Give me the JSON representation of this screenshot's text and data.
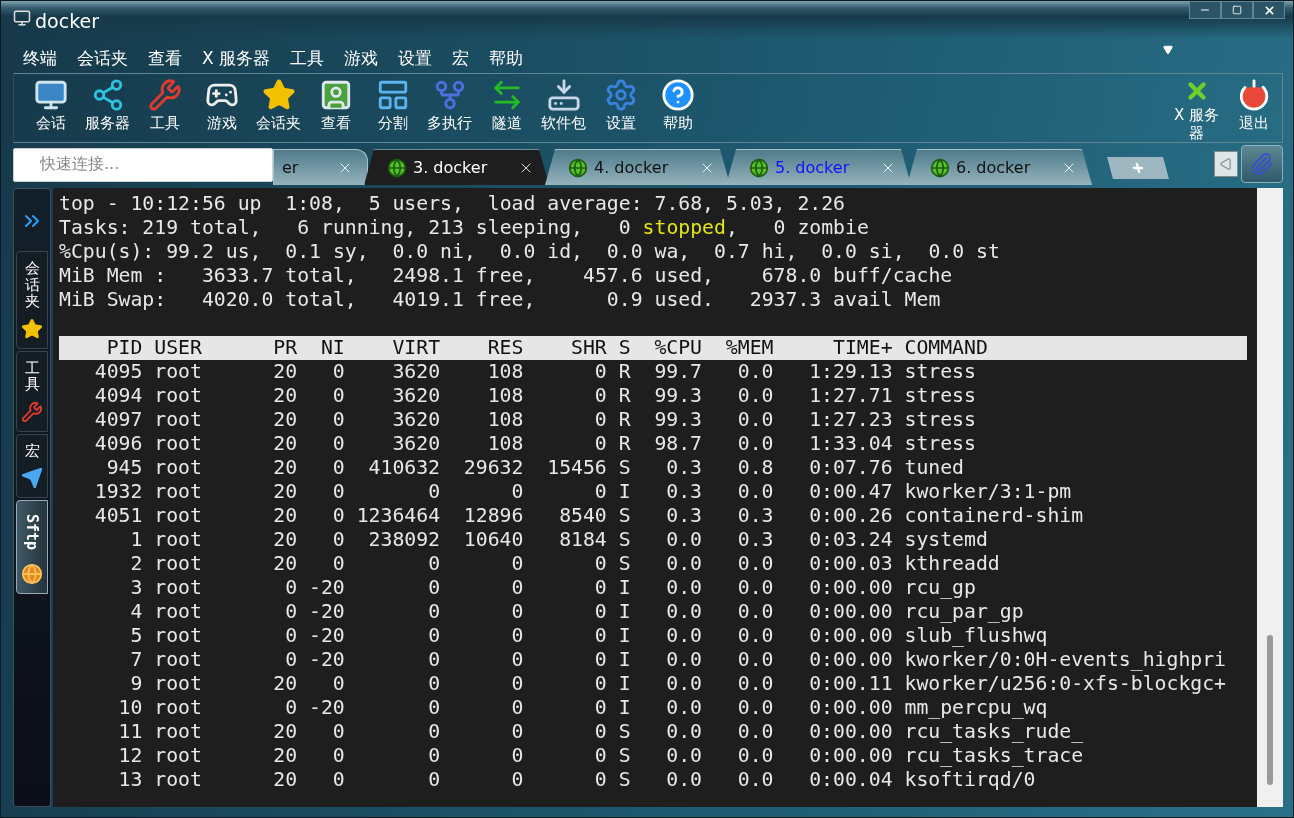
{
  "window": {
    "title": "docker"
  },
  "menu": [
    "终端",
    "会话夹",
    "查看",
    "X 服务器",
    "工具",
    "游戏",
    "设置",
    "宏",
    "帮助"
  ],
  "toolbar": [
    {
      "kind": "session",
      "label": "会话"
    },
    {
      "kind": "servers",
      "label": "服务器"
    },
    {
      "kind": "tools",
      "label": "工具"
    },
    {
      "kind": "games",
      "label": "游戏"
    },
    {
      "kind": "sessions",
      "label": "会话夹"
    },
    {
      "kind": "view",
      "label": "查看"
    },
    {
      "kind": "split",
      "label": "分割"
    },
    {
      "kind": "multiexec",
      "label": "多执行"
    },
    {
      "kind": "tunnel",
      "label": "隧道"
    },
    {
      "kind": "packages",
      "label": "软件包"
    },
    {
      "kind": "settings",
      "label": "设置"
    },
    {
      "kind": "help",
      "label": "帮助"
    }
  ],
  "toolbar_right": [
    {
      "kind": "xserver",
      "label": "X 服务器"
    },
    {
      "kind": "exit",
      "label": "退出"
    }
  ],
  "quick_connect": {
    "placeholder": "快速连接..."
  },
  "tabs": [
    {
      "label": "er",
      "selected": false,
      "activity": false,
      "icon": false
    },
    {
      "label": "3. docker",
      "selected": true,
      "activity": false,
      "icon": true
    },
    {
      "label": "4. docker",
      "selected": false,
      "activity": false,
      "icon": true
    },
    {
      "label": "5. docker",
      "selected": false,
      "activity": true,
      "icon": true
    },
    {
      "label": "6. docker",
      "selected": false,
      "activity": false,
      "icon": true
    }
  ],
  "side_tabs": [
    {
      "kind": "sessions",
      "label": "会话夹",
      "selected": false
    },
    {
      "kind": "tools",
      "label": "工具",
      "selected": false
    },
    {
      "kind": "macros",
      "label": "宏",
      "selected": false
    },
    {
      "kind": "sftp",
      "label": "Sftp",
      "selected": true
    }
  ],
  "summary": [
    [
      {
        "text": "top - 10:12:56 up  1:08,  5 users,  load average: 7.68, 5.03, 2.26",
        "highlight": false
      }
    ],
    [
      {
        "text": "Tasks: 219 total,   6 running, 213 sleeping,   0 ",
        "highlight": false
      },
      {
        "text": "stopped",
        "highlight": true
      },
      {
        "text": ",   0 zombie",
        "highlight": false
      }
    ],
    [
      {
        "text": "%Cpu(s): 99.2 us,  0.1 sy,  0.0 ni,  0.0 id,  0.0 wa,  0.7 hi,  0.0 si,  0.0 st",
        "highlight": false
      }
    ],
    [
      {
        "text": "MiB Mem :   3633.7 total,   2498.1 free,    457.6 used,    678.0 buff/cache",
        "highlight": false
      }
    ],
    [
      {
        "text": "MiB Swap:   4020.0 total,   4019.1 free,      0.9 used.   2937.3 avail Mem",
        "highlight": false
      }
    ]
  ],
  "process_table": {
    "columns": [
      "PID",
      "USER",
      "PR",
      "NI",
      "VIRT",
      "RES",
      "SHR",
      "S",
      "%CPU",
      "%MEM",
      "TIME+",
      "COMMAND"
    ],
    "rows": [
      [
        "4095",
        "root",
        "20",
        "0",
        "3620",
        "108",
        "0",
        "R",
        "99.7",
        "0.0",
        "1:29.13",
        "stress"
      ],
      [
        "4094",
        "root",
        "20",
        "0",
        "3620",
        "108",
        "0",
        "R",
        "99.3",
        "0.0",
        "1:27.71",
        "stress"
      ],
      [
        "4097",
        "root",
        "20",
        "0",
        "3620",
        "108",
        "0",
        "R",
        "99.3",
        "0.0",
        "1:27.23",
        "stress"
      ],
      [
        "4096",
        "root",
        "20",
        "0",
        "3620",
        "108",
        "0",
        "R",
        "98.7",
        "0.0",
        "1:33.04",
        "stress"
      ],
      [
        "945",
        "root",
        "20",
        "0",
        "410632",
        "29632",
        "15456",
        "S",
        "0.3",
        "0.8",
        "0:07.76",
        "tuned"
      ],
      [
        "1932",
        "root",
        "20",
        "0",
        "0",
        "0",
        "0",
        "I",
        "0.3",
        "0.0",
        "0:00.47",
        "kworker/3:1-pm"
      ],
      [
        "4051",
        "root",
        "20",
        "0",
        "1236464",
        "12896",
        "8540",
        "S",
        "0.3",
        "0.3",
        "0:00.26",
        "containerd-shim"
      ],
      [
        "1",
        "root",
        "20",
        "0",
        "238092",
        "10640",
        "8184",
        "S",
        "0.0",
        "0.3",
        "0:03.24",
        "systemd"
      ],
      [
        "2",
        "root",
        "20",
        "0",
        "0",
        "0",
        "0",
        "S",
        "0.0",
        "0.0",
        "0:00.03",
        "kthreadd"
      ],
      [
        "3",
        "root",
        "0",
        "-20",
        "0",
        "0",
        "0",
        "I",
        "0.0",
        "0.0",
        "0:00.00",
        "rcu_gp"
      ],
      [
        "4",
        "root",
        "0",
        "-20",
        "0",
        "0",
        "0",
        "I",
        "0.0",
        "0.0",
        "0:00.00",
        "rcu_par_gp"
      ],
      [
        "5",
        "root",
        "0",
        "-20",
        "0",
        "0",
        "0",
        "I",
        "0.0",
        "0.0",
        "0:00.00",
        "slub_flushwq"
      ],
      [
        "7",
        "root",
        "0",
        "-20",
        "0",
        "0",
        "0",
        "I",
        "0.0",
        "0.0",
        "0:00.00",
        "kworker/0:0H-events_highpri"
      ],
      [
        "9",
        "root",
        "20",
        "0",
        "0",
        "0",
        "0",
        "I",
        "0.0",
        "0.0",
        "0:00.11",
        "kworker/u256:0-xfs-blockgc+"
      ],
      [
        "10",
        "root",
        "0",
        "-20",
        "0",
        "0",
        "0",
        "I",
        "0.0",
        "0.0",
        "0:00.00",
        "mm_percpu_wq"
      ],
      [
        "11",
        "root",
        "20",
        "0",
        "0",
        "0",
        "0",
        "S",
        "0.0",
        "0.0",
        "0:00.00",
        "rcu_tasks_rude_"
      ],
      [
        "12",
        "root",
        "20",
        "0",
        "0",
        "0",
        "0",
        "S",
        "0.0",
        "0.0",
        "0:00.00",
        "rcu_tasks_trace"
      ],
      [
        "13",
        "root",
        "20",
        "0",
        "0",
        "0",
        "0",
        "S",
        "0.0",
        "0.0",
        "0:00.04",
        "ksoftirqd/0"
      ]
    ]
  }
}
